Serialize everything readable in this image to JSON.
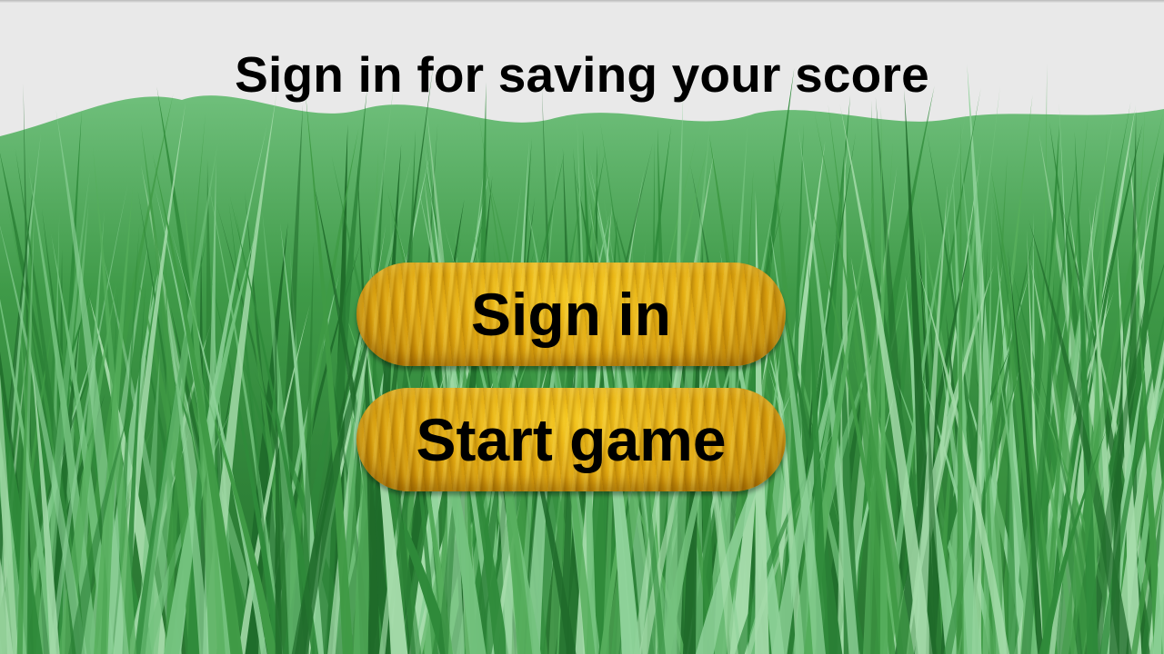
{
  "screen": {
    "title": "Sign in for saving your score"
  },
  "buttons": {
    "sign_in": "Sign in",
    "start_game": "Start game"
  },
  "colors": {
    "background_sky": "#e9e9e9",
    "grass_dark": "#1f6b2a",
    "grass_mid": "#3f9a45",
    "grass_light": "#8fd29a",
    "button_gold": "#dca10c",
    "text": "#000000"
  }
}
